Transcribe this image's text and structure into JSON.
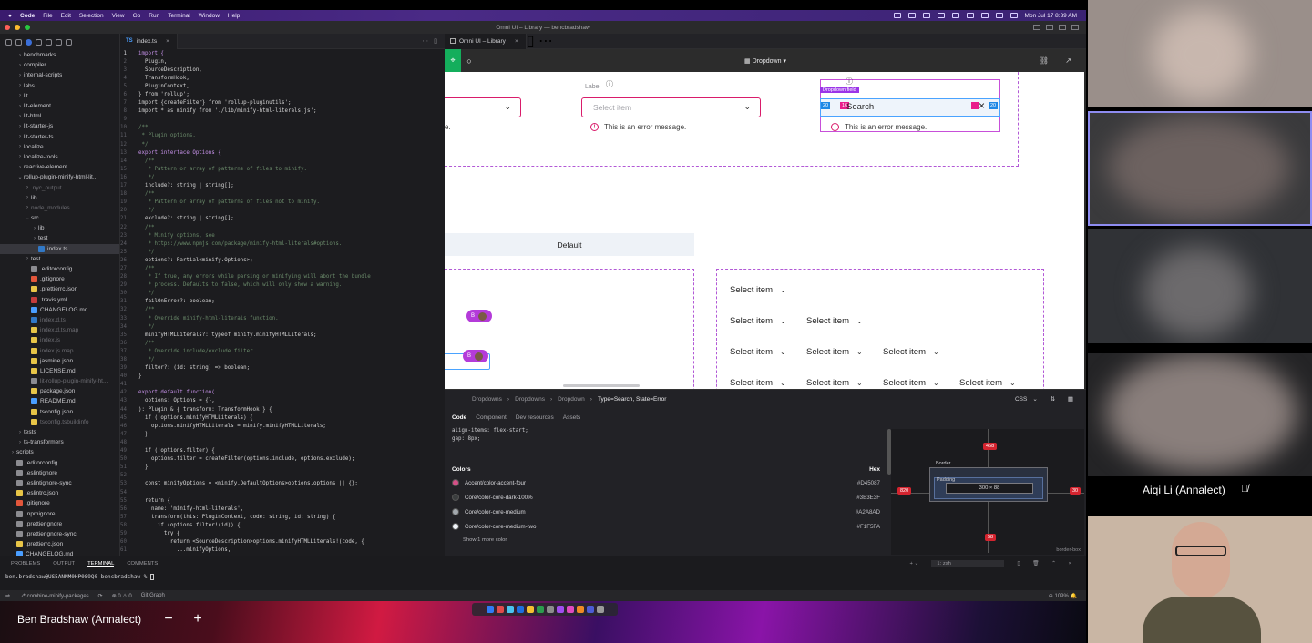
{
  "menubar": {
    "items": [
      "Code",
      "File",
      "Edit",
      "Selection",
      "View",
      "Go",
      "Run",
      "Terminal",
      "Window",
      "Help"
    ],
    "clock": "Mon Jul 17  8:39 AM"
  },
  "window": {
    "title": "Omni UI – Library — bencbradshaw"
  },
  "explorer": {
    "files": [
      {
        "name": "benchmarks",
        "depth": 1,
        "kind": "folder",
        "open": false,
        "dim": false,
        "sel": false
      },
      {
        "name": "compiler",
        "depth": 1,
        "kind": "folder",
        "open": false,
        "dim": false,
        "sel": false
      },
      {
        "name": "internal-scripts",
        "depth": 1,
        "kind": "folder",
        "open": false,
        "dim": false,
        "sel": false
      },
      {
        "name": "labs",
        "depth": 1,
        "kind": "folder",
        "open": false,
        "dim": false,
        "sel": false
      },
      {
        "name": "lit",
        "depth": 1,
        "kind": "folder",
        "open": false,
        "dim": false,
        "sel": false
      },
      {
        "name": "lit-element",
        "depth": 1,
        "kind": "folder",
        "open": false,
        "dim": false,
        "sel": false
      },
      {
        "name": "lit-html",
        "depth": 1,
        "kind": "folder",
        "open": false,
        "dim": false,
        "sel": false
      },
      {
        "name": "lit-starter-js",
        "depth": 1,
        "kind": "folder",
        "open": false,
        "dim": false,
        "sel": false
      },
      {
        "name": "lit-starter-ts",
        "depth": 1,
        "kind": "folder",
        "open": false,
        "dim": false,
        "sel": false
      },
      {
        "name": "localize",
        "depth": 1,
        "kind": "folder",
        "open": false,
        "dim": false,
        "sel": false
      },
      {
        "name": "localize-tools",
        "depth": 1,
        "kind": "folder",
        "open": false,
        "dim": false,
        "sel": false
      },
      {
        "name": "reactive-element",
        "depth": 1,
        "kind": "folder",
        "open": false,
        "dim": false,
        "sel": false
      },
      {
        "name": "rollup-plugin-minify-html-lit...",
        "depth": 1,
        "kind": "folder",
        "open": true,
        "dim": false,
        "sel": false
      },
      {
        "name": ".nyc_output",
        "depth": 2,
        "kind": "folder",
        "open": false,
        "dim": true,
        "sel": false
      },
      {
        "name": "lib",
        "depth": 2,
        "kind": "folder",
        "open": false,
        "dim": false,
        "sel": false
      },
      {
        "name": "node_modules",
        "depth": 2,
        "kind": "folder",
        "open": false,
        "dim": true,
        "sel": false
      },
      {
        "name": "src",
        "depth": 2,
        "kind": "folder",
        "open": true,
        "dim": false,
        "sel": false
      },
      {
        "name": "lib",
        "depth": 3,
        "kind": "folder",
        "open": false,
        "dim": false,
        "sel": false
      },
      {
        "name": "test",
        "depth": 3,
        "kind": "folder",
        "open": false,
        "dim": false,
        "sel": false
      },
      {
        "name": "index.ts",
        "depth": 3,
        "kind": "ts",
        "open": false,
        "dim": false,
        "sel": true
      },
      {
        "name": "test",
        "depth": 2,
        "kind": "folder",
        "open": false,
        "dim": false,
        "sel": false
      },
      {
        "name": ".editorconfig",
        "depth": 2,
        "kind": "cfg",
        "open": false,
        "dim": false,
        "sel": false
      },
      {
        "name": ".gitignore",
        "depth": 2,
        "kind": "git",
        "open": false,
        "dim": false,
        "sel": false
      },
      {
        "name": ".prettierrc.json",
        "depth": 2,
        "kind": "json",
        "open": false,
        "dim": false,
        "sel": false
      },
      {
        "name": ".travis.yml",
        "depth": 2,
        "kind": "yml",
        "open": false,
        "dim": false,
        "sel": false
      },
      {
        "name": "CHANGELOG.md",
        "depth": 2,
        "kind": "md",
        "open": false,
        "dim": false,
        "sel": false
      },
      {
        "name": "index.d.ts",
        "depth": 2,
        "kind": "ts",
        "open": false,
        "dim": true,
        "sel": false
      },
      {
        "name": "index.d.ts.map",
        "depth": 2,
        "kind": "json",
        "open": false,
        "dim": true,
        "sel": false
      },
      {
        "name": "index.js",
        "depth": 2,
        "kind": "js",
        "open": false,
        "dim": true,
        "sel": false
      },
      {
        "name": "index.js.map",
        "depth": 2,
        "kind": "json",
        "open": false,
        "dim": true,
        "sel": false
      },
      {
        "name": "jasmine.json",
        "depth": 2,
        "kind": "json",
        "open": false,
        "dim": false,
        "sel": false
      },
      {
        "name": "LICENSE.md",
        "depth": 2,
        "kind": "lic",
        "open": false,
        "dim": false,
        "sel": false
      },
      {
        "name": "lit-rollup-plugin-minify-ht...",
        "depth": 2,
        "kind": "cfg",
        "open": false,
        "dim": true,
        "sel": false
      },
      {
        "name": "package.json",
        "depth": 2,
        "kind": "json",
        "open": false,
        "dim": false,
        "sel": false
      },
      {
        "name": "README.md",
        "depth": 2,
        "kind": "md",
        "open": false,
        "dim": false,
        "sel": false
      },
      {
        "name": "tsconfig.json",
        "depth": 2,
        "kind": "json",
        "open": false,
        "dim": false,
        "sel": false
      },
      {
        "name": "tsconfig.tsbuildinfo",
        "depth": 2,
        "kind": "json",
        "open": false,
        "dim": true,
        "sel": false
      },
      {
        "name": "tests",
        "depth": 1,
        "kind": "folder",
        "open": false,
        "dim": false,
        "sel": false
      },
      {
        "name": "ts-transformers",
        "depth": 1,
        "kind": "folder",
        "open": false,
        "dim": false,
        "sel": false
      },
      {
        "name": "scripts",
        "depth": 0,
        "kind": "folder",
        "open": false,
        "dim": false,
        "sel": false
      },
      {
        "name": ".editorconfig",
        "depth": 0,
        "kind": "cfg",
        "open": false,
        "dim": false,
        "sel": false
      },
      {
        "name": ".eslintignore",
        "depth": 0,
        "kind": "cfg",
        "open": false,
        "dim": false,
        "sel": false
      },
      {
        "name": ".eslintignore-sync",
        "depth": 0,
        "kind": "cfg",
        "open": false,
        "dim": false,
        "sel": false
      },
      {
        "name": ".eslintrc.json",
        "depth": 0,
        "kind": "json",
        "open": false,
        "dim": false,
        "sel": false
      },
      {
        "name": ".gitignore",
        "depth": 0,
        "kind": "git",
        "open": false,
        "dim": false,
        "sel": false
      },
      {
        "name": ".npmignore",
        "depth": 0,
        "kind": "cfg",
        "open": false,
        "dim": false,
        "sel": false
      },
      {
        "name": ".prettierignore",
        "depth": 0,
        "kind": "cfg",
        "open": false,
        "dim": false,
        "sel": false
      },
      {
        "name": ".prettierignore-sync",
        "depth": 0,
        "kind": "cfg",
        "open": false,
        "dim": false,
        "sel": false
      },
      {
        "name": ".prettierrc.json",
        "depth": 0,
        "kind": "json",
        "open": false,
        "dim": false,
        "sel": false
      },
      {
        "name": "CHANGELOG.md",
        "depth": 0,
        "kind": "md",
        "open": false,
        "dim": false,
        "sel": false
      }
    ]
  },
  "editor": {
    "tab": "index.ts",
    "current_line": 1,
    "lines": [
      {
        "t": "import {",
        "c": "kw"
      },
      {
        "t": "  Plugin,",
        "c": ""
      },
      {
        "t": "  SourceDescription,",
        "c": ""
      },
      {
        "t": "  TransformHook,",
        "c": ""
      },
      {
        "t": "  PluginContext,",
        "c": ""
      },
      {
        "t": "} from 'rollup';",
        "c": ""
      },
      {
        "t": "import {createFilter} from 'rollup-pluginutils';",
        "c": ""
      },
      {
        "t": "import * as minify from './lib/minify-html-literals.js';",
        "c": ""
      },
      {
        "t": "",
        "c": ""
      },
      {
        "t": "/**",
        "c": "cm"
      },
      {
        "t": " * Plugin options.",
        "c": "cm"
      },
      {
        "t": " */",
        "c": "cm"
      },
      {
        "t": "export interface Options {",
        "c": "kw"
      },
      {
        "t": "  /**",
        "c": "cm"
      },
      {
        "t": "   * Pattern or array of patterns of files to minify.",
        "c": "cm"
      },
      {
        "t": "   */",
        "c": "cm"
      },
      {
        "t": "  include?: string | string[];",
        "c": ""
      },
      {
        "t": "  /**",
        "c": "cm"
      },
      {
        "t": "   * Pattern or array of patterns of files not to minify.",
        "c": "cm"
      },
      {
        "t": "   */",
        "c": "cm"
      },
      {
        "t": "  exclude?: string | string[];",
        "c": ""
      },
      {
        "t": "  /**",
        "c": "cm"
      },
      {
        "t": "   * Minify options, see",
        "c": "cm"
      },
      {
        "t": "   * https://www.npmjs.com/package/minify-html-literals#options.",
        "c": "cm"
      },
      {
        "t": "   */",
        "c": "cm"
      },
      {
        "t": "  options?: Partial<minify.Options>;",
        "c": ""
      },
      {
        "t": "  /**",
        "c": "cm"
      },
      {
        "t": "   * If true, any errors while parsing or minifying will abort the bundle",
        "c": "cm"
      },
      {
        "t": "   * process. Defaults to false, which will only show a warning.",
        "c": "cm"
      },
      {
        "t": "   */",
        "c": "cm"
      },
      {
        "t": "  failOnError?: boolean;",
        "c": ""
      },
      {
        "t": "  /**",
        "c": "cm"
      },
      {
        "t": "   * Override minify-html-literals function.",
        "c": "cm"
      },
      {
        "t": "   */",
        "c": "cm"
      },
      {
        "t": "  minifyHTMLLiterals?: typeof minify.minifyHTMLLiterals;",
        "c": ""
      },
      {
        "t": "  /**",
        "c": "cm"
      },
      {
        "t": "   * Override include/exclude filter.",
        "c": "cm"
      },
      {
        "t": "   */",
        "c": "cm"
      },
      {
        "t": "  filter?: (id: string) => boolean;",
        "c": ""
      },
      {
        "t": "}",
        "c": ""
      },
      {
        "t": "",
        "c": ""
      },
      {
        "t": "export default function(",
        "c": "kw"
      },
      {
        "t": "  options: Options = {},",
        "c": ""
      },
      {
        "t": "): Plugin & { transform: TransformHook } {",
        "c": ""
      },
      {
        "t": "  if (!options.minifyHTMLLiterals) {",
        "c": ""
      },
      {
        "t": "    options.minifyHTMLLiterals = minify.minifyHTMLLiterals;",
        "c": ""
      },
      {
        "t": "  }",
        "c": ""
      },
      {
        "t": "",
        "c": ""
      },
      {
        "t": "  if (!options.filter) {",
        "c": ""
      },
      {
        "t": "    options.filter = createFilter(options.include, options.exclude);",
        "c": ""
      },
      {
        "t": "  }",
        "c": ""
      },
      {
        "t": "",
        "c": ""
      },
      {
        "t": "  const minifyOptions = <minify.DefaultOptions>options.options || {};",
        "c": ""
      },
      {
        "t": "",
        "c": ""
      },
      {
        "t": "  return {",
        "c": ""
      },
      {
        "t": "    name: 'minify-html-literals',",
        "c": ""
      },
      {
        "t": "    transform(this: PluginContext, code: string, id: string) {",
        "c": ""
      },
      {
        "t": "      if (options.filter!(id)) {",
        "c": ""
      },
      {
        "t": "        try {",
        "c": ""
      },
      {
        "t": "          return <SourceDescription>options.minifyHTMLLiterals!(code, {",
        "c": ""
      },
      {
        "t": "            ...minifyOptions,",
        "c": ""
      }
    ]
  },
  "figma": {
    "tab": "Omni UI – Library",
    "page": "Dropdown",
    "canvas": {
      "label_text": "Label",
      "select_placeholder": "Select item",
      "error_message": "This is an error message.",
      "fragment_text": "e.",
      "search_text": "Search",
      "dropdown_field_tag": "Dropdown field",
      "badge_20a": "20",
      "badge_16": "16",
      "badge_20b": "20",
      "default_label": "Default",
      "select_items": "Select item",
      "avatar_b": "B"
    },
    "inspect": {
      "breadcrumbs": [
        "Dropdowns",
        "Dropdowns",
        "Dropdown",
        "Type=Search, State=Error"
      ],
      "lang": "CSS",
      "subtabs": [
        "Code",
        "Component",
        "Dev resources",
        "Assets"
      ],
      "code_lines": [
        "align-items: flex-start;",
        "gap: 8px;"
      ],
      "colors_title": "Colors",
      "hex_title": "Hex",
      "colors": [
        {
          "name": "Accent/color-accent-four",
          "hex": "#D45087",
          "swatch": "#D45087"
        },
        {
          "name": "Core/color-core-dark-100%",
          "hex": "#3B3E3F",
          "swatch": "#3B3E3F"
        },
        {
          "name": "Core/color-core-medium",
          "hex": "#A2A8AD",
          "swatch": "#A2A8AD"
        },
        {
          "name": "Core/color-core-medium-two",
          "hex": "#F1F5FA",
          "swatch": "#F1F5FA"
        }
      ],
      "show_more": "Show 1 more color",
      "box": {
        "border_label": "Border",
        "padding_label": "Padding",
        "size": "300 × 88",
        "top": "468",
        "left": "820",
        "right": "30",
        "bottom": "58",
        "footer": "border-box"
      }
    }
  },
  "terminal": {
    "tabs": [
      "PROBLEMS",
      "OUTPUT",
      "TERMINAL",
      "COMMENTS"
    ],
    "prompt": "ben.bradshaw@US5ANNM0HP0S9Q0 bencbradshaw % ",
    "shell": "1: zsh"
  },
  "statusbar": {
    "branch": "combine-minify-packages",
    "problems": "⊗ 0  ⚠ 0",
    "graph": "Git Graph",
    "zoom": "109%"
  },
  "zoom": {
    "self_name": "Ben Bradshaw (Annalect)",
    "participant_name": "Aiqi Li (Annalect)"
  }
}
